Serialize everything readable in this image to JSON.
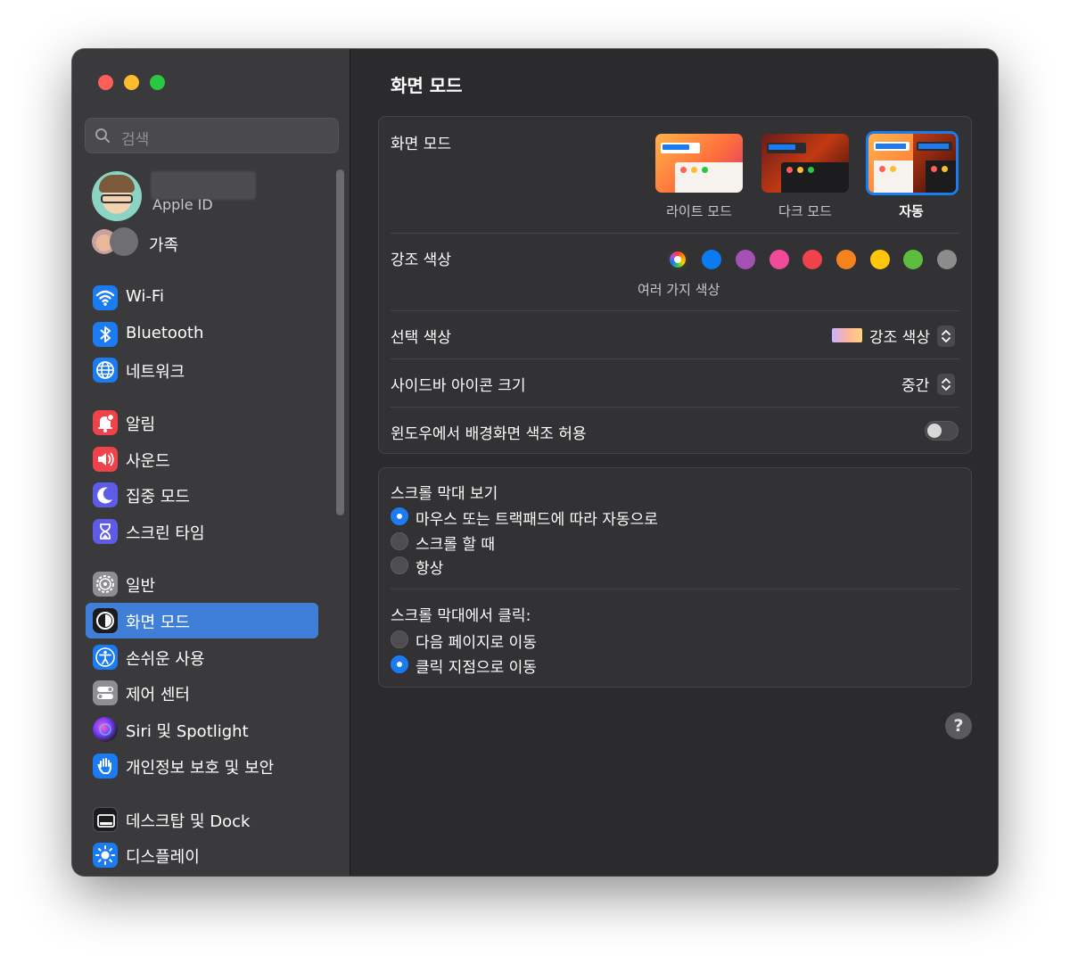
{
  "sidebar": {
    "search_placeholder": "검색",
    "apple_id_label": "Apple ID",
    "family_label": "가족",
    "items": [
      {
        "label": "Wi-Fi",
        "icon": "wifi-icon"
      },
      {
        "label": "Bluetooth",
        "icon": "bluetooth-icon"
      },
      {
        "label": "네트워크",
        "icon": "globe-icon"
      },
      {
        "label": "알림",
        "icon": "bell-icon"
      },
      {
        "label": "사운드",
        "icon": "speaker-icon"
      },
      {
        "label": "집중 모드",
        "icon": "moon-icon"
      },
      {
        "label": "스크린 타임",
        "icon": "hourglass-icon"
      },
      {
        "label": "일반",
        "icon": "gear-icon"
      },
      {
        "label": "화면 모드",
        "icon": "appearance-icon"
      },
      {
        "label": "손쉬운 사용",
        "icon": "accessibility-icon"
      },
      {
        "label": "제어 센터",
        "icon": "toggles-icon"
      },
      {
        "label": "Siri 및 Spotlight",
        "icon": "siri-icon"
      },
      {
        "label": "개인정보 보호 및 보안",
        "icon": "hand-icon"
      },
      {
        "label": "데스크탑 및 Dock",
        "icon": "dock-icon"
      },
      {
        "label": "디스플레이",
        "icon": "sun-icon"
      }
    ],
    "selected_index": 8
  },
  "main": {
    "title": "화면 모드",
    "appearance": {
      "label": "화면 모드",
      "options": [
        {
          "label": "라이트 모드",
          "selected": false
        },
        {
          "label": "다크 모드",
          "selected": false
        },
        {
          "label": "자동",
          "selected": true
        }
      ]
    },
    "accent": {
      "label": "강조 색상",
      "caption": "여러 가지 색상",
      "colors": [
        "multicolor",
        "#0a7bf0",
        "#a550b5",
        "#f04a98",
        "#f0424a",
        "#f6821f",
        "#ffc60a",
        "#5fbd3e",
        "#8c8c8c"
      ]
    },
    "highlight": {
      "label": "선택 색상",
      "value": "강조 색상"
    },
    "sidebar_icon_size": {
      "label": "사이드바 아이콘 크기",
      "value": "중간"
    },
    "wallpaper_tinting": {
      "label": "윈도우에서 배경화면 색조 허용",
      "enabled": false
    },
    "scrollbars": {
      "label": "스크롤 막대 보기",
      "options": [
        {
          "label": "마우스 또는 트랙패드에 따라 자동으로",
          "selected": true
        },
        {
          "label": "스크롤 할 때",
          "selected": false
        },
        {
          "label": "항상",
          "selected": false
        }
      ]
    },
    "scroll_click": {
      "label": "스크롤 막대에서 클릭:",
      "options": [
        {
          "label": "다음 페이지로 이동",
          "selected": false
        },
        {
          "label": "클릭 지점으로 이동",
          "selected": true
        }
      ]
    },
    "help_label": "?"
  }
}
